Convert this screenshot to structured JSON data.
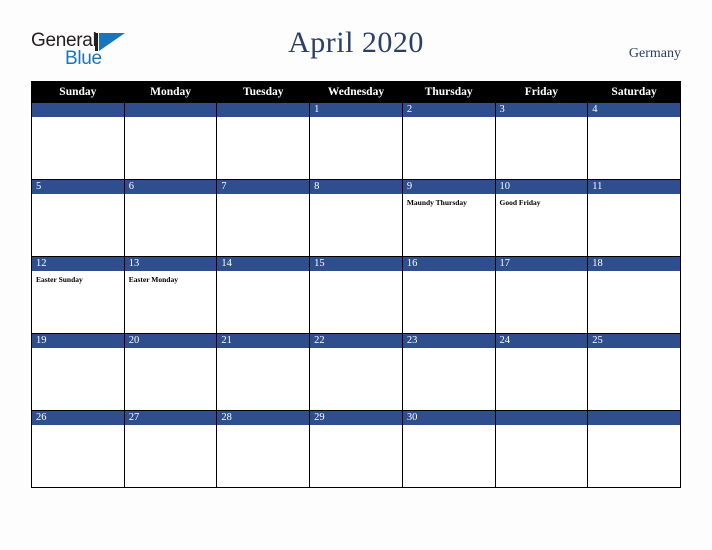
{
  "logo": {
    "word_one": "General",
    "word_two": "Blue",
    "mark": "triangle-logo-icon",
    "color_dark": "#231f20",
    "color_blue": "#1b75bb"
  },
  "header": {
    "title": "April 2020",
    "country": "Germany",
    "title_color": "#2c3f66"
  },
  "calendar": {
    "weekday_headers": [
      "Sunday",
      "Monday",
      "Tuesday",
      "Wednesday",
      "Thursday",
      "Friday",
      "Saturday"
    ],
    "accent_color": "#2e4e8d",
    "header_bg": "#000000",
    "weeks": [
      [
        {
          "day": "",
          "holiday": ""
        },
        {
          "day": "",
          "holiday": ""
        },
        {
          "day": "",
          "holiday": ""
        },
        {
          "day": "1",
          "holiday": ""
        },
        {
          "day": "2",
          "holiday": ""
        },
        {
          "day": "3",
          "holiday": ""
        },
        {
          "day": "4",
          "holiday": ""
        }
      ],
      [
        {
          "day": "5",
          "holiday": ""
        },
        {
          "day": "6",
          "holiday": ""
        },
        {
          "day": "7",
          "holiday": ""
        },
        {
          "day": "8",
          "holiday": ""
        },
        {
          "day": "9",
          "holiday": "Maundy Thursday"
        },
        {
          "day": "10",
          "holiday": "Good Friday"
        },
        {
          "day": "11",
          "holiday": ""
        }
      ],
      [
        {
          "day": "12",
          "holiday": "Easter Sunday"
        },
        {
          "day": "13",
          "holiday": "Easter Monday"
        },
        {
          "day": "14",
          "holiday": ""
        },
        {
          "day": "15",
          "holiday": ""
        },
        {
          "day": "16",
          "holiday": ""
        },
        {
          "day": "17",
          "holiday": ""
        },
        {
          "day": "18",
          "holiday": ""
        }
      ],
      [
        {
          "day": "19",
          "holiday": ""
        },
        {
          "day": "20",
          "holiday": ""
        },
        {
          "day": "21",
          "holiday": ""
        },
        {
          "day": "22",
          "holiday": ""
        },
        {
          "day": "23",
          "holiday": ""
        },
        {
          "day": "24",
          "holiday": ""
        },
        {
          "day": "25",
          "holiday": ""
        }
      ],
      [
        {
          "day": "26",
          "holiday": ""
        },
        {
          "day": "27",
          "holiday": ""
        },
        {
          "day": "28",
          "holiday": ""
        },
        {
          "day": "29",
          "holiday": ""
        },
        {
          "day": "30",
          "holiday": ""
        },
        {
          "day": "",
          "holiday": ""
        },
        {
          "day": "",
          "holiday": ""
        }
      ]
    ]
  }
}
